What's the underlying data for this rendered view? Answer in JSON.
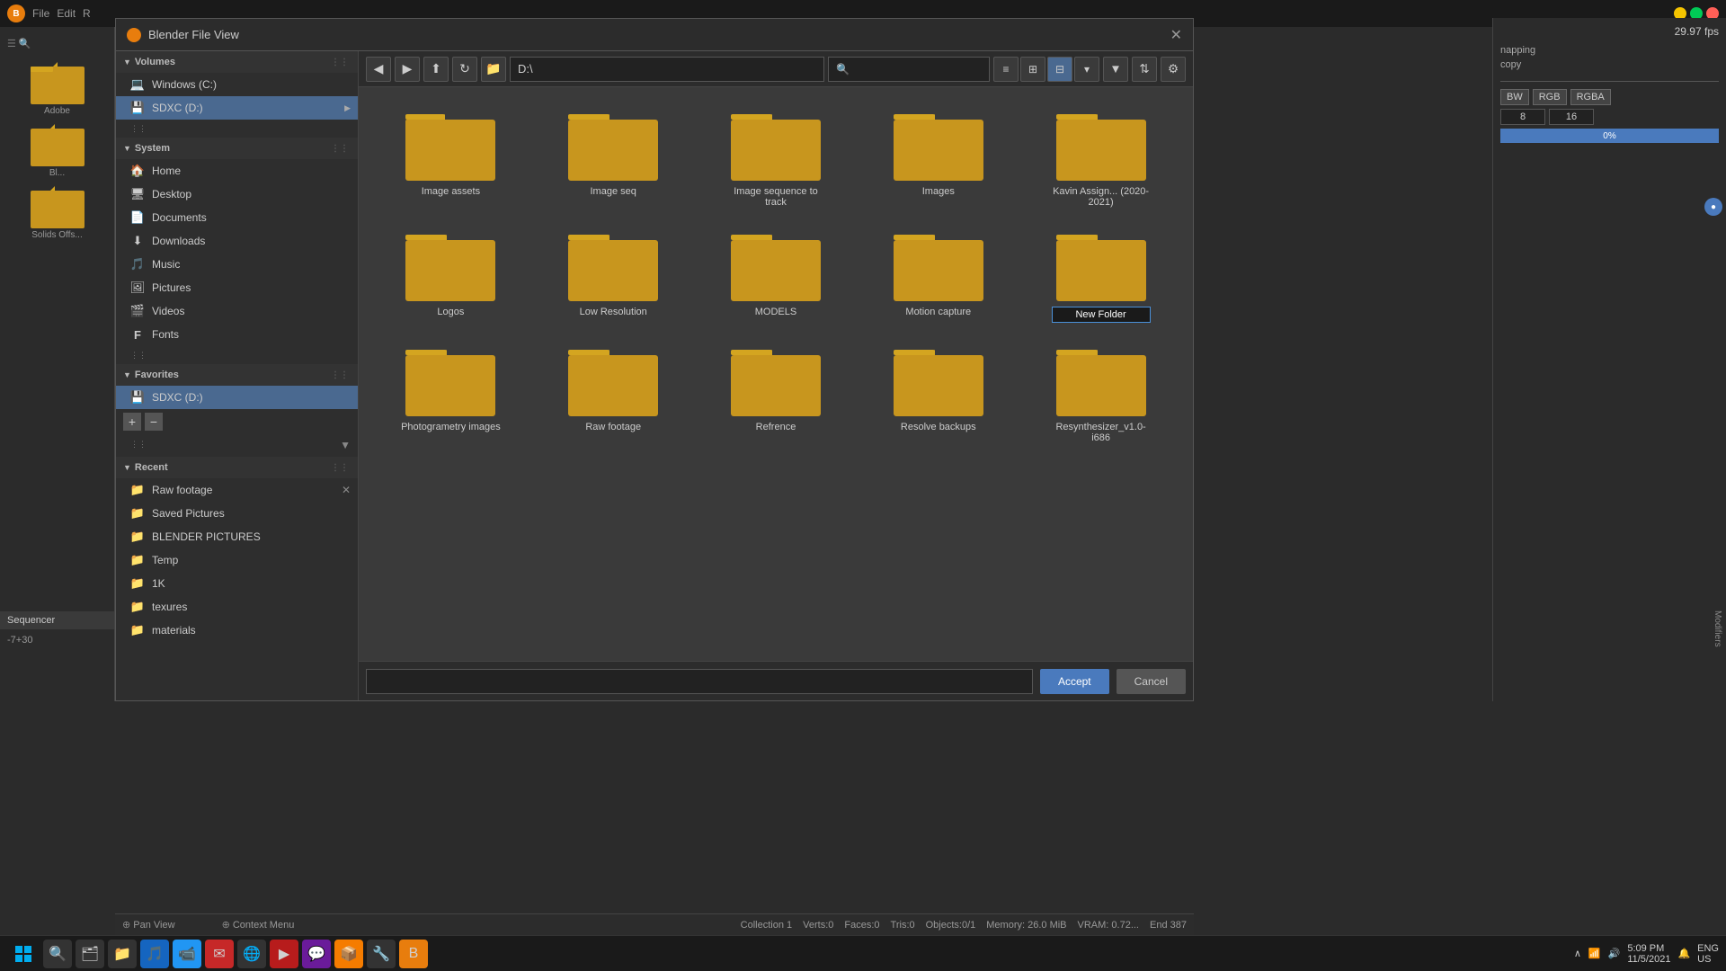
{
  "titlebar": {
    "app_name": "Blender",
    "menu_items": [
      "File",
      "Edit",
      "R"
    ]
  },
  "file_dialog": {
    "title": "Blender File View",
    "path": "D:\\",
    "search_placeholder": "",
    "accept_label": "Accept",
    "cancel_label": "Cancel",
    "filename_value": ""
  },
  "sidebar": {
    "volumes_label": "Volumes",
    "volumes": [
      {
        "label": "Windows (C:)",
        "icon": "💻",
        "active": false
      },
      {
        "label": "SDXC (D:)",
        "icon": "💾",
        "active": true
      }
    ],
    "system_label": "System",
    "system_items": [
      {
        "label": "Home",
        "icon": "🏠"
      },
      {
        "label": "Desktop",
        "icon": "🖥"
      },
      {
        "label": "Documents",
        "icon": "📄"
      },
      {
        "label": "Downloads",
        "icon": "⬇"
      },
      {
        "label": "Music",
        "icon": "🎵"
      },
      {
        "label": "Pictures",
        "icon": "🖼"
      },
      {
        "label": "Videos",
        "icon": "🎬"
      },
      {
        "label": "Fonts",
        "icon": "F"
      }
    ],
    "favorites_label": "Favorites",
    "favorites": [
      {
        "label": "SDXC (D:)",
        "icon": "💾",
        "active": true
      }
    ],
    "recent_label": "Recent",
    "recent_items": [
      {
        "label": "Raw footage"
      },
      {
        "label": "Saved Pictures"
      },
      {
        "label": "BLENDER PICTURES"
      },
      {
        "label": "Temp"
      },
      {
        "label": "1K"
      },
      {
        "label": "texures"
      },
      {
        "label": "materials"
      }
    ]
  },
  "toolbar": {
    "back_label": "◀",
    "forward_label": "▶",
    "up_label": "⬆",
    "refresh_label": "↻",
    "new_folder_label": "📁",
    "view_list_label": "≡",
    "view_icon_label": "⊞",
    "view_grid_label": "⊟",
    "view_expand_label": "▾",
    "filter_label": "▼",
    "sort_label": "⇅",
    "settings_label": "⚙"
  },
  "folders": [
    {
      "name": "Image assets"
    },
    {
      "name": "Image seq"
    },
    {
      "name": "Image sequence to track"
    },
    {
      "name": "Images"
    },
    {
      "name": "Kavin Assign... (2020-2021)"
    },
    {
      "name": "Logos"
    },
    {
      "name": "Low Resolution"
    },
    {
      "name": "MODELS"
    },
    {
      "name": "Motion capture"
    },
    {
      "name": "New Folder",
      "editing": true
    },
    {
      "name": "Photogrametry images"
    },
    {
      "name": "Raw footage"
    },
    {
      "name": "Refrence"
    },
    {
      "name": "Resolve backups"
    },
    {
      "name": "Resynthesizer_v1.0-i686"
    }
  ],
  "right_panel": {
    "fps_label": "29.97 fps",
    "mapping_label": "napping",
    "copy_label": "copy",
    "channel_labels": [
      "BW",
      "RGB",
      "RGBA"
    ],
    "channel_value1": "8",
    "channel_value2": "16",
    "progress_label": "0%"
  },
  "status_bar": {
    "collection": "Collection 1",
    "verts": "Verts:0",
    "faces": "Faces:0",
    "tris": "Tris:0",
    "objects": "Objects:0/1",
    "memory": "Memory: 26.0 MiB",
    "vram": "VRAM: 0.72..."
  },
  "bottom_panel": {
    "pan_view_label": "Pan View",
    "context_menu_label": "Context Menu",
    "end_label": "End",
    "end_value": "387"
  },
  "sequencer": {
    "label": "Sequencer",
    "value": "-7+30"
  },
  "taskbar": {
    "time": "5:09 PM",
    "date": "11/5/2021",
    "language": "ENG\nUS"
  },
  "left_panel": {
    "folder1_label": "Adobe",
    "folder2_label": "Bl...",
    "folder3_label": "Solids Offs..."
  },
  "colors": {
    "folder_body": "#c8961e",
    "folder_top": "#d4a520",
    "folder_shadow": "#b07c10",
    "accent_blue": "#4a7abd",
    "active_bg": "#4a6990"
  }
}
